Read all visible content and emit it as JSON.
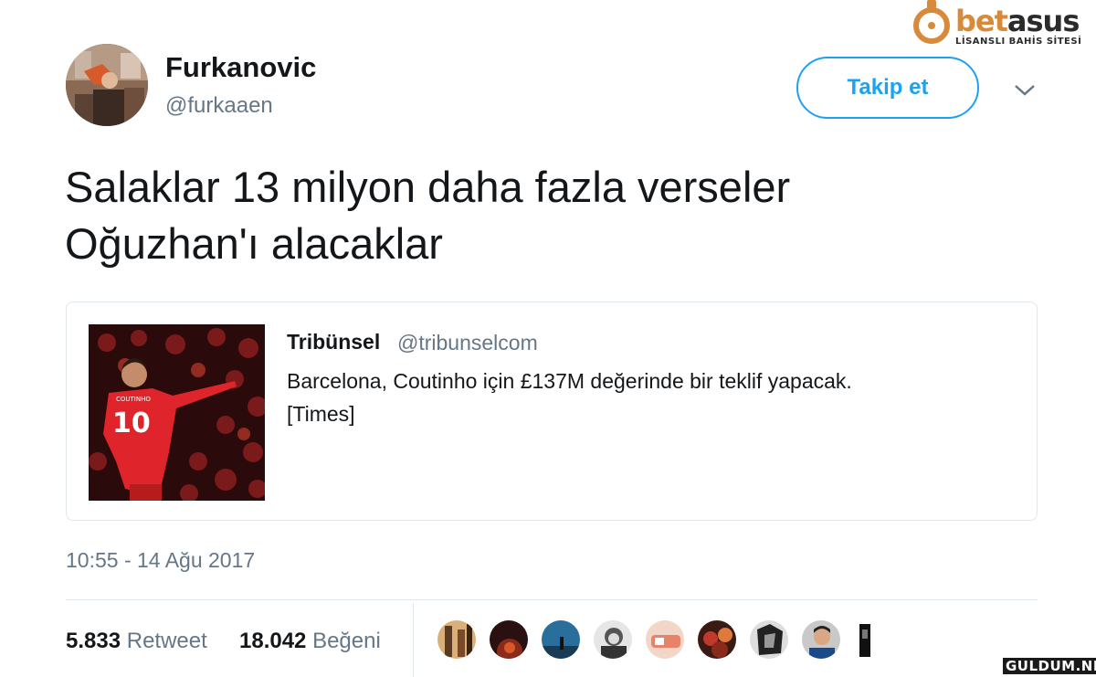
{
  "watermark": {
    "brand_bet": "bet",
    "brand_asus": "asus",
    "subtitle": "LİSANSLI BAHİS SİTESİ",
    "bottom": "GULDUM.NET",
    "accent_color": "#d8893a"
  },
  "tweet": {
    "author": {
      "name": "Furkanovic",
      "handle": "@furkaaen",
      "avatar_icon": "user-avatar"
    },
    "follow_label": "Takip et",
    "menu_icon": "chevron-down-icon",
    "text_line1": "Salaklar 13 milyon daha fazla verseler",
    "text_line2": "Oğuzhan'ı alacaklar",
    "quoted": {
      "name": "Tribünsel",
      "handle": "@tribunselcom",
      "text_line1": "Barcelona, Coutinho için £137M değerinde bir teklif yapacak.",
      "text_line2": "[Times]",
      "image_jersey_name": "COUTINHO",
      "image_jersey_number": "10"
    },
    "timestamp": "10:55 - 14 Ağu 2017",
    "stats": {
      "retweets_count": "5.833",
      "retweets_label": "Retweet",
      "likes_count": "18.042",
      "likes_label": "Beğeni"
    },
    "likers_count_shown": 9
  },
  "colors": {
    "accent": "#1da1f2",
    "text": "#14171a",
    "secondary": "#657786",
    "border": "#e1e8ed"
  }
}
